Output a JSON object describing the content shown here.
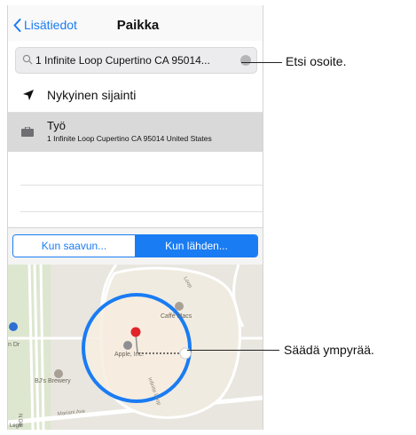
{
  "nav": {
    "back_label": "Lisätiedot",
    "title": "Paikka"
  },
  "search": {
    "value": "1 Infinite Loop Cupertino CA 95014..."
  },
  "current_location": {
    "label": "Nykyinen sijainti"
  },
  "work": {
    "name": "Työ",
    "address": "1 Infinite Loop Cupertino CA 95014 United States"
  },
  "segment": {
    "arriving": "Kun saavun...",
    "leaving": "Kun lähden...",
    "selected": "leaving"
  },
  "map": {
    "labels": {
      "caffe": "Caffè Macs",
      "apple": "Apple, Inc.",
      "brewery": "BJ's Brewery",
      "infinite_loop": "Infinite Loop",
      "mariani": "Mariani Ave",
      "loop_top": "Loop",
      "n_dr": "n Dr",
      "n_de": "N De",
      "legal": "Legal"
    },
    "accent": "#1a7cf3",
    "pin_color": "#e0252a"
  },
  "callouts": {
    "search": "Etsi osoite.",
    "circle": "Säädä ympyrää."
  }
}
